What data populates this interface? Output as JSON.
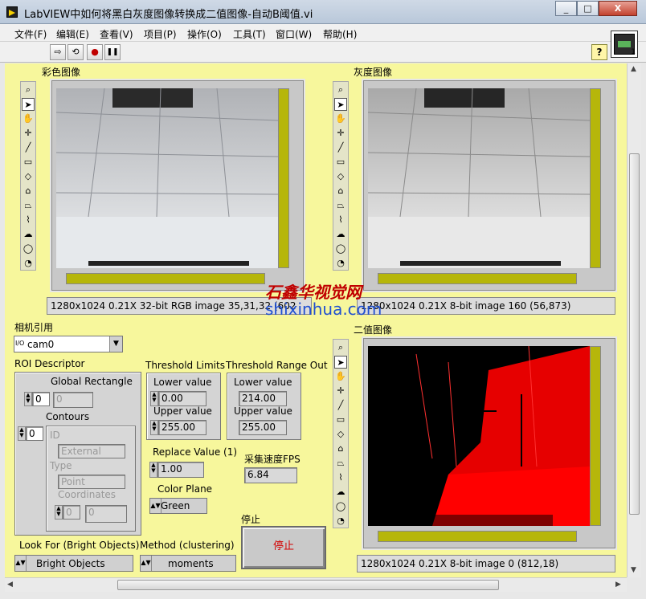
{
  "window": {
    "title": "LabVIEW中如何将黑白灰度图像转换成二值图像-自动B阈值.vi",
    "minimize": "_",
    "restore": "□",
    "close": "X"
  },
  "menu": [
    "文件(F)",
    "编辑(E)",
    "查看(V)",
    "项目(P)",
    "操作(O)",
    "工具(T)",
    "窗口(W)",
    "帮助(H)"
  ],
  "toolbar": {
    "run": "⇨",
    "run_continuous": "⟲",
    "abort": "●",
    "pause": "❚❚",
    "help": "?",
    "vi_icon_number": "1"
  },
  "color_display": {
    "label": "彩色图像",
    "status": "1280x1024 0.21X 32-bit RGB image 35,31,32   (602"
  },
  "gray_display": {
    "label": "灰度图像",
    "status": "1280x1024 0.21X 8-bit image 160      (56,873)"
  },
  "binary_display": {
    "label": "二值图像",
    "status": "1280x1024 0.21X 8-bit image 0     (812,18)"
  },
  "palette_tools": [
    "zoom-icon",
    "pointer-icon",
    "pan-icon",
    "crosshair-icon",
    "line-icon",
    "rect-icon",
    "rotated-rect-icon",
    "annulus-icon",
    "polygon-icon",
    "freehand-icon",
    "freehand-region-icon",
    "oval-icon",
    "spiral-icon"
  ],
  "palette_glyphs": [
    "⌕",
    "➤",
    "✋",
    "✛",
    "╱",
    "▭",
    "◇",
    "⌂",
    "⏢",
    "⌇",
    "☁",
    "◯",
    "◔"
  ],
  "camera": {
    "label": "相机引用",
    "value": "cam0",
    "prefix": "I/O"
  },
  "roi": {
    "label": "ROI Descriptor",
    "index": "0",
    "global_rect_label": "Global Rectangle",
    "global_rect_value": "0",
    "contours_label": "Contours",
    "contours_index": "0",
    "id_label": "ID",
    "id_value": "External",
    "type_label": "Type",
    "type_value": "Point",
    "coords_label": "Coordinates",
    "coords_index": "0",
    "coords_value": "0"
  },
  "threshold_limits": {
    "label": "Threshold Limits",
    "lower_label": "Lower value",
    "lower": "0.00",
    "upper_label": "Upper value",
    "upper": "255.00"
  },
  "threshold_range_out": {
    "label": "Threshold Range Out",
    "lower_label": "Lower value",
    "lower": "214.00",
    "upper_label": "Upper value",
    "upper": "255.00"
  },
  "replace_value": {
    "label": "Replace Value (1)",
    "value": "1.00"
  },
  "fps": {
    "label": "采集速度FPS",
    "value": "6.84"
  },
  "color_plane": {
    "label": "Color Plane",
    "value": "Green"
  },
  "stop": {
    "label": "停止",
    "button": "停止"
  },
  "look_for": {
    "label": "Look For (Bright Objects)",
    "value": "Bright Objects"
  },
  "method": {
    "label": "Method (clustering)",
    "value": "moments"
  },
  "watermark": {
    "cn": "石鑫华视觉网",
    "url": "shixinhua.com"
  },
  "colors": {
    "panel": "#f7f79c",
    "scroll_olive": "#b6b60a",
    "binary_red": "#ff0000"
  }
}
